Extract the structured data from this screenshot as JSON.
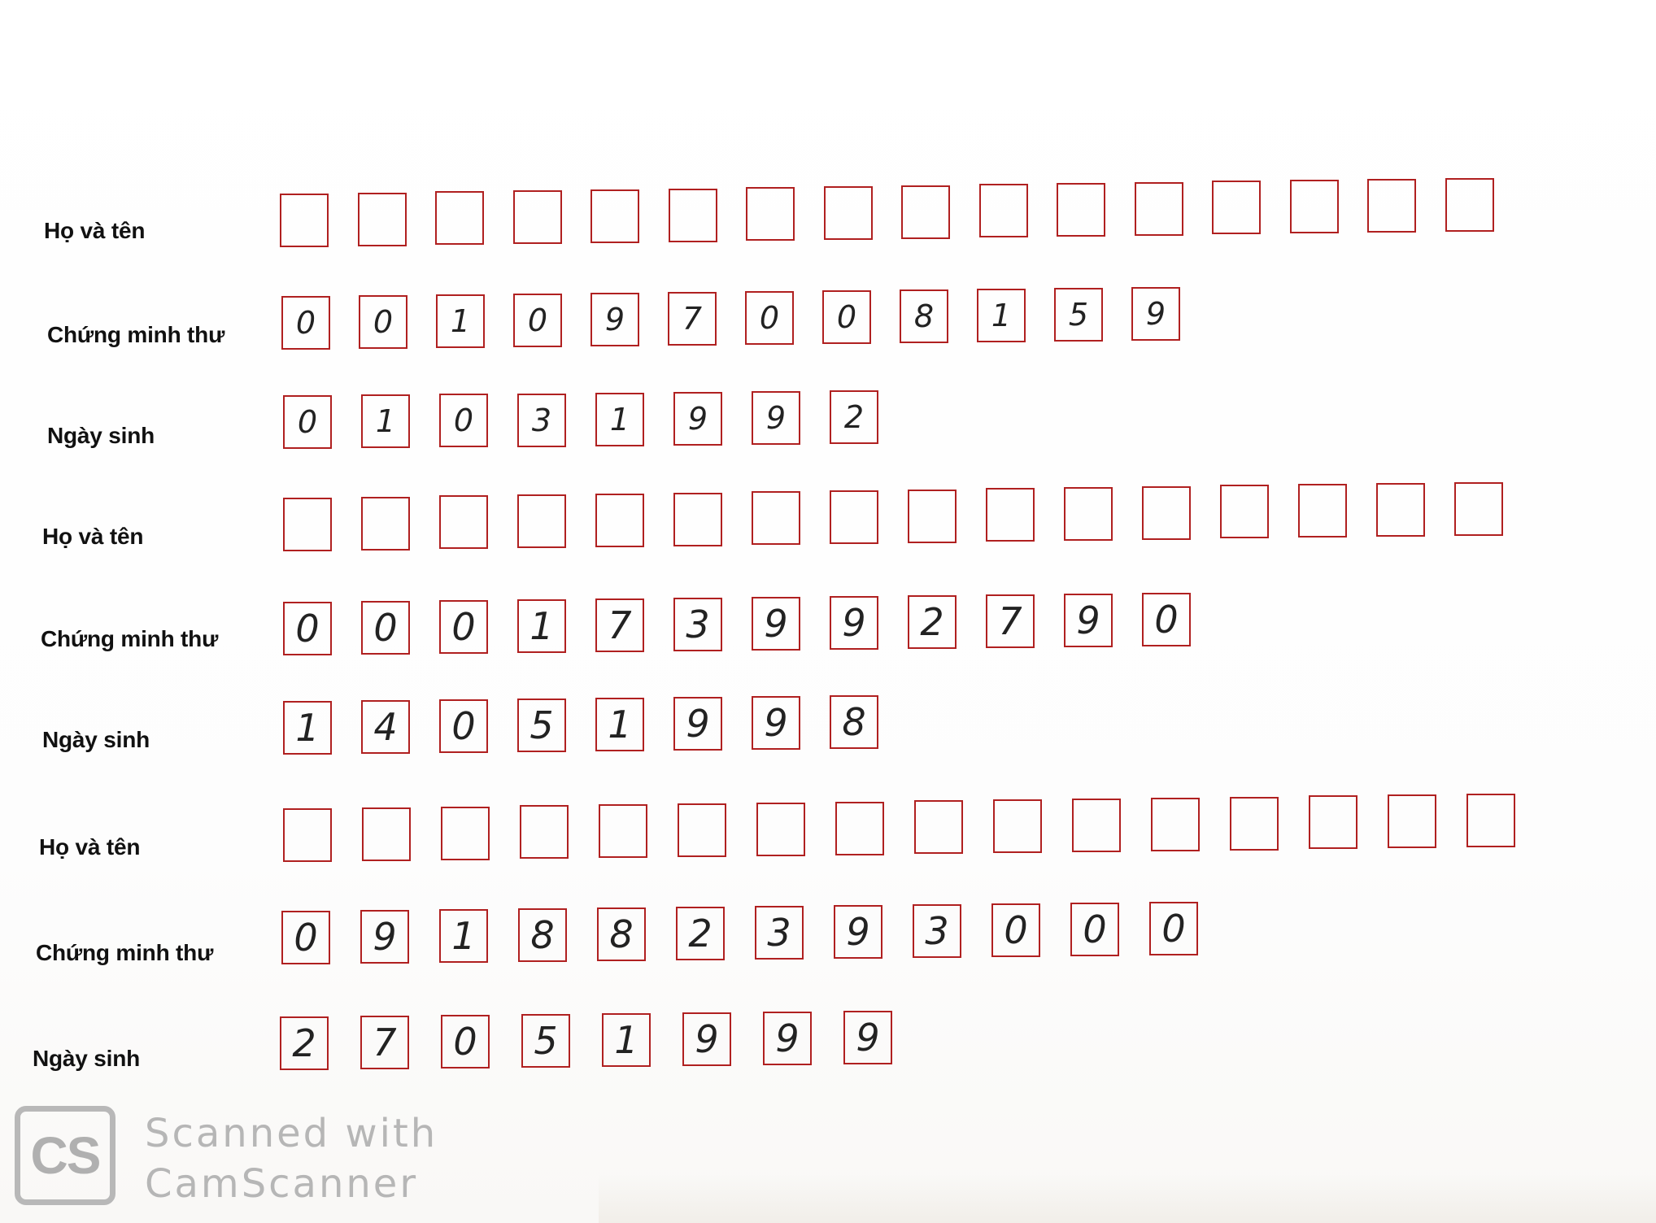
{
  "form": {
    "label_name": "Họ và tên",
    "label_id": "Chứng minh thư",
    "label_dob": "Ngày sinh"
  },
  "records": [
    {
      "name_boxes": [
        "",
        "",
        "",
        "",
        "",
        "",
        "",
        "",
        "",
        "",
        "",
        "",
        "",
        "",
        "",
        ""
      ],
      "id_digits": [
        "0",
        "0",
        "1",
        "0",
        "9",
        "7",
        "0",
        "0",
        "8",
        "1",
        "5",
        "9"
      ],
      "dob_digits": [
        "0",
        "1",
        "0",
        "3",
        "1",
        "9",
        "9",
        "2"
      ]
    },
    {
      "name_boxes": [
        "",
        "",
        "",
        "",
        "",
        "",
        "",
        "",
        "",
        "",
        "",
        "",
        "",
        "",
        "",
        ""
      ],
      "id_digits": [
        "0",
        "0",
        "0",
        "1",
        "7",
        "3",
        "9",
        "9",
        "2",
        "7",
        "9",
        "0"
      ],
      "dob_digits": [
        "1",
        "4",
        "0",
        "5",
        "1",
        "9",
        "9",
        "8"
      ]
    },
    {
      "name_boxes": [
        "",
        "",
        "",
        "",
        "",
        "",
        "",
        "",
        "",
        "",
        "",
        "",
        "",
        "",
        "",
        ""
      ],
      "id_digits": [
        "0",
        "9",
        "1",
        "8",
        "8",
        "2",
        "3",
        "9",
        "3",
        "0",
        "0",
        "0"
      ],
      "dob_digits": [
        "2",
        "7",
        "0",
        "5",
        "1",
        "9",
        "9",
        "9"
      ]
    }
  ],
  "watermark": {
    "logo": "CS",
    "line1": "Scanned with",
    "line2": "CamScanner"
  },
  "colors": {
    "box_border": "#b02020",
    "label_text": "#111111",
    "watermark": "#b6b6b6"
  }
}
